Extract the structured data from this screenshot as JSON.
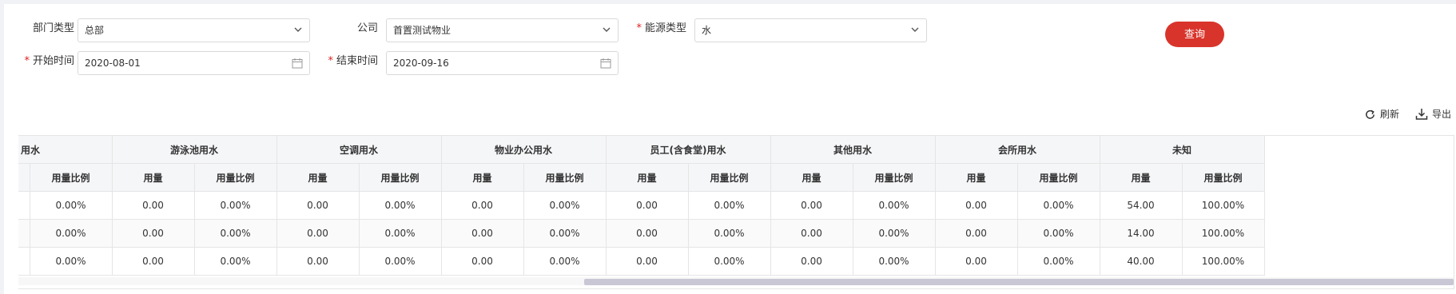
{
  "filters": {
    "dept_type": {
      "label": "部门类型",
      "value": "总部"
    },
    "company": {
      "label": "公司",
      "value": "首置测试物业"
    },
    "energy_type": {
      "label": "能源类型",
      "value": "水",
      "required": true
    },
    "start_time": {
      "label": "开始时间",
      "value": "2020-08-01",
      "required": true
    },
    "end_time": {
      "label": "结束时间",
      "value": "2020-09-16",
      "required": true
    },
    "required_mark": "*",
    "query_label": "查询"
  },
  "toolbar": {
    "refresh_label": "刷新",
    "export_label": "导出"
  },
  "table": {
    "groups": [
      "用水",
      "游泳池用水",
      "空调用水",
      "物业办公用水",
      "员工(含食堂)用水",
      "其他用水",
      "会所用水",
      "未知"
    ],
    "sub_headers": {
      "usage": "用量",
      "ratio": "用量比例"
    },
    "rows": [
      [
        "",
        "0.00%",
        "0.00",
        "0.00%",
        "0.00",
        "0.00%",
        "0.00",
        "0.00%",
        "0.00",
        "0.00%",
        "0.00",
        "0.00%",
        "0.00",
        "0.00%",
        "54.00",
        "100.00%"
      ],
      [
        "",
        "0.00%",
        "0.00",
        "0.00%",
        "0.00",
        "0.00%",
        "0.00",
        "0.00%",
        "0.00",
        "0.00%",
        "0.00",
        "0.00%",
        "0.00",
        "0.00%",
        "14.00",
        "100.00%"
      ],
      [
        "",
        "0.00%",
        "0.00",
        "0.00%",
        "0.00",
        "0.00%",
        "0.00",
        "0.00%",
        "0.00",
        "0.00%",
        "0.00",
        "0.00%",
        "0.00",
        "0.00%",
        "40.00",
        "100.00%"
      ]
    ]
  },
  "colors": {
    "accent": "#d9342b",
    "required": "#e02020",
    "header_bg": "#f5f6f8",
    "scroll_thumb": "#c9c7d6"
  },
  "icons": {
    "dropdown": "chevron-down-icon",
    "date": "calendar-icon",
    "refresh": "refresh-icon",
    "export": "download-icon"
  }
}
